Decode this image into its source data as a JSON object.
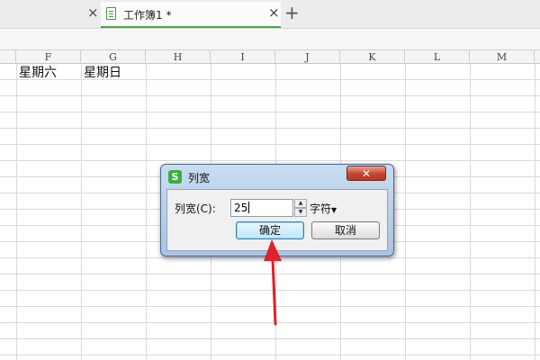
{
  "tabs": {
    "left_close": "×",
    "active_title": "工作簿1 *",
    "active_close": "×",
    "new_tab": "+"
  },
  "sheet": {
    "columns": [
      "F",
      "G",
      "H",
      "I",
      "J",
      "K",
      "L",
      "M"
    ],
    "cells": {
      "F1": "星期六",
      "G1": "星期日"
    }
  },
  "dialog": {
    "app_icon_glyph": "S",
    "title": "列宽",
    "close_glyph": "✕",
    "field_label": "列宽(C):",
    "field_value": "25",
    "unit": "字符",
    "ok_label": "确定",
    "cancel_label": "取消"
  },
  "colors": {
    "accent_green": "#4aa84a",
    "arrow_red": "#e0202a",
    "dialog_frame": "#a9c3e2"
  }
}
